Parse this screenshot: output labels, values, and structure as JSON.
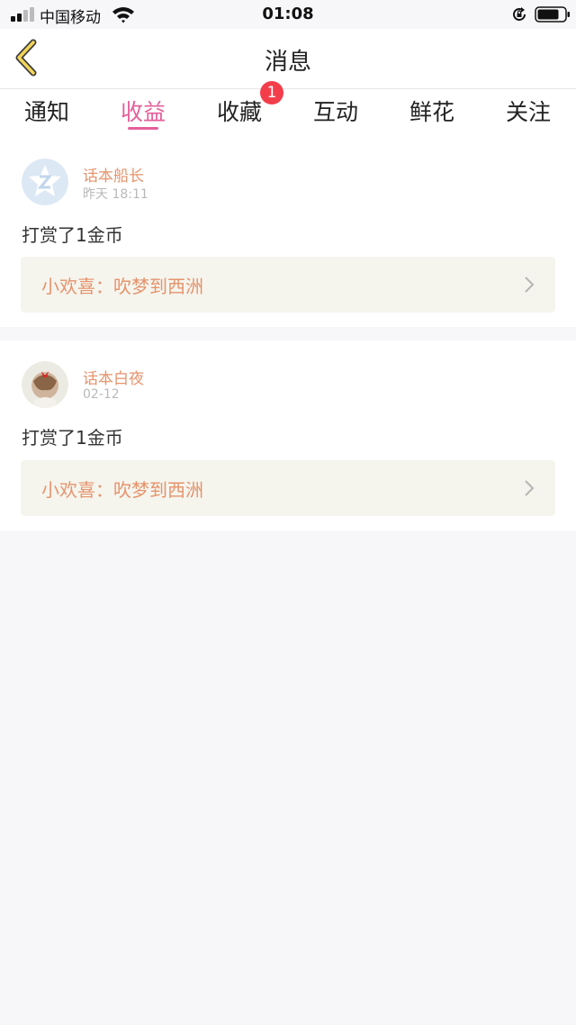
{
  "status_bar": {
    "carrier": "中国移动",
    "time": "01:08"
  },
  "nav": {
    "title": "消息"
  },
  "tabs": {
    "items": [
      {
        "label": "通知"
      },
      {
        "label": "收益"
      },
      {
        "label": "收藏"
      },
      {
        "label": "互动"
      },
      {
        "label": "鲜花"
      },
      {
        "label": "关注"
      }
    ],
    "active_index": 1,
    "badge_count": "1"
  },
  "messages": [
    {
      "user": "话本船长",
      "time": "昨天 18:11",
      "text": "打赏了1金币",
      "link": "小欢喜：吹梦到西洲"
    },
    {
      "user": "话本白夜",
      "time": "02-12",
      "text": "打赏了1金币",
      "link": "小欢喜：吹梦到西洲"
    }
  ],
  "colors": {
    "accent": "#e45f9b",
    "name": "#e6936b",
    "badge": "#f43d4b",
    "background": "#f7f6f9"
  }
}
